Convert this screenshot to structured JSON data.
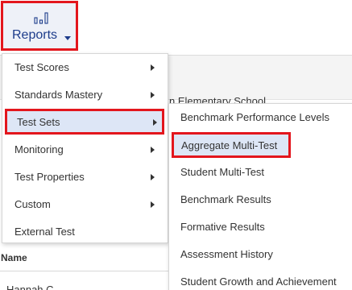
{
  "header": {
    "reports_label": "Reports",
    "reports_icon": "bar-chart-icon",
    "caret_icon": "caret-down-icon"
  },
  "background": {
    "school_text": "n Elementary School",
    "name_header": "Name",
    "row_text": "Hannah C..."
  },
  "menu": {
    "items": [
      {
        "label": "Test Scores",
        "has_submenu": true
      },
      {
        "label": "Standards Mastery",
        "has_submenu": true
      },
      {
        "label": "Test Sets",
        "has_submenu": true
      },
      {
        "label": "Monitoring",
        "has_submenu": true
      },
      {
        "label": "Test Properties",
        "has_submenu": true
      },
      {
        "label": "Custom",
        "has_submenu": true
      },
      {
        "label": "External Test",
        "has_submenu": false
      }
    ],
    "active_index": 2
  },
  "submenu": {
    "items": [
      {
        "label": "Benchmark Performance Levels"
      },
      {
        "label": "Aggregate Multi-Test"
      },
      {
        "label": "Student Multi-Test"
      },
      {
        "label": "Benchmark Results"
      },
      {
        "label": "Formative Results"
      },
      {
        "label": "Assessment History"
      },
      {
        "label": "Student Growth and Achievement"
      }
    ],
    "active_index": 1
  },
  "colors": {
    "highlight_border": "#e3161d",
    "active_bg": "#dde6f6",
    "brand_text": "#1d3c8b"
  }
}
